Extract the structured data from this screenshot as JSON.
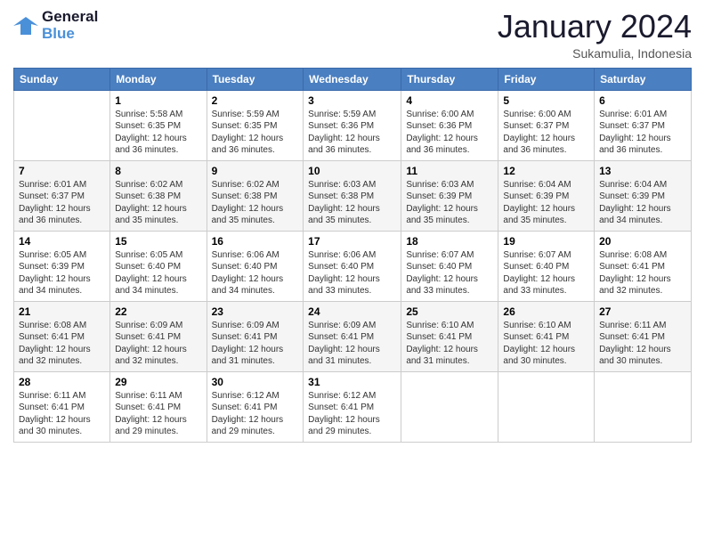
{
  "logo": {
    "line1": "General",
    "line2": "Blue"
  },
  "header": {
    "month": "January 2024",
    "location": "Sukamulia, Indonesia"
  },
  "weekdays": [
    "Sunday",
    "Monday",
    "Tuesday",
    "Wednesday",
    "Thursday",
    "Friday",
    "Saturday"
  ],
  "weeks": [
    [
      {
        "day": "",
        "info": ""
      },
      {
        "day": "1",
        "info": "Sunrise: 5:58 AM\nSunset: 6:35 PM\nDaylight: 12 hours and 36 minutes."
      },
      {
        "day": "2",
        "info": "Sunrise: 5:59 AM\nSunset: 6:35 PM\nDaylight: 12 hours and 36 minutes."
      },
      {
        "day": "3",
        "info": "Sunrise: 5:59 AM\nSunset: 6:36 PM\nDaylight: 12 hours and 36 minutes."
      },
      {
        "day": "4",
        "info": "Sunrise: 6:00 AM\nSunset: 6:36 PM\nDaylight: 12 hours and 36 minutes."
      },
      {
        "day": "5",
        "info": "Sunrise: 6:00 AM\nSunset: 6:37 PM\nDaylight: 12 hours and 36 minutes."
      },
      {
        "day": "6",
        "info": "Sunrise: 6:01 AM\nSunset: 6:37 PM\nDaylight: 12 hours and 36 minutes."
      }
    ],
    [
      {
        "day": "7",
        "info": "Sunrise: 6:01 AM\nSunset: 6:37 PM\nDaylight: 12 hours and 36 minutes."
      },
      {
        "day": "8",
        "info": "Sunrise: 6:02 AM\nSunset: 6:38 PM\nDaylight: 12 hours and 35 minutes."
      },
      {
        "day": "9",
        "info": "Sunrise: 6:02 AM\nSunset: 6:38 PM\nDaylight: 12 hours and 35 minutes."
      },
      {
        "day": "10",
        "info": "Sunrise: 6:03 AM\nSunset: 6:38 PM\nDaylight: 12 hours and 35 minutes."
      },
      {
        "day": "11",
        "info": "Sunrise: 6:03 AM\nSunset: 6:39 PM\nDaylight: 12 hours and 35 minutes."
      },
      {
        "day": "12",
        "info": "Sunrise: 6:04 AM\nSunset: 6:39 PM\nDaylight: 12 hours and 35 minutes."
      },
      {
        "day": "13",
        "info": "Sunrise: 6:04 AM\nSunset: 6:39 PM\nDaylight: 12 hours and 34 minutes."
      }
    ],
    [
      {
        "day": "14",
        "info": "Sunrise: 6:05 AM\nSunset: 6:39 PM\nDaylight: 12 hours and 34 minutes."
      },
      {
        "day": "15",
        "info": "Sunrise: 6:05 AM\nSunset: 6:40 PM\nDaylight: 12 hours and 34 minutes."
      },
      {
        "day": "16",
        "info": "Sunrise: 6:06 AM\nSunset: 6:40 PM\nDaylight: 12 hours and 34 minutes."
      },
      {
        "day": "17",
        "info": "Sunrise: 6:06 AM\nSunset: 6:40 PM\nDaylight: 12 hours and 33 minutes."
      },
      {
        "day": "18",
        "info": "Sunrise: 6:07 AM\nSunset: 6:40 PM\nDaylight: 12 hours and 33 minutes."
      },
      {
        "day": "19",
        "info": "Sunrise: 6:07 AM\nSunset: 6:40 PM\nDaylight: 12 hours and 33 minutes."
      },
      {
        "day": "20",
        "info": "Sunrise: 6:08 AM\nSunset: 6:41 PM\nDaylight: 12 hours and 32 minutes."
      }
    ],
    [
      {
        "day": "21",
        "info": "Sunrise: 6:08 AM\nSunset: 6:41 PM\nDaylight: 12 hours and 32 minutes."
      },
      {
        "day": "22",
        "info": "Sunrise: 6:09 AM\nSunset: 6:41 PM\nDaylight: 12 hours and 32 minutes."
      },
      {
        "day": "23",
        "info": "Sunrise: 6:09 AM\nSunset: 6:41 PM\nDaylight: 12 hours and 31 minutes."
      },
      {
        "day": "24",
        "info": "Sunrise: 6:09 AM\nSunset: 6:41 PM\nDaylight: 12 hours and 31 minutes."
      },
      {
        "day": "25",
        "info": "Sunrise: 6:10 AM\nSunset: 6:41 PM\nDaylight: 12 hours and 31 minutes."
      },
      {
        "day": "26",
        "info": "Sunrise: 6:10 AM\nSunset: 6:41 PM\nDaylight: 12 hours and 30 minutes."
      },
      {
        "day": "27",
        "info": "Sunrise: 6:11 AM\nSunset: 6:41 PM\nDaylight: 12 hours and 30 minutes."
      }
    ],
    [
      {
        "day": "28",
        "info": "Sunrise: 6:11 AM\nSunset: 6:41 PM\nDaylight: 12 hours and 30 minutes."
      },
      {
        "day": "29",
        "info": "Sunrise: 6:11 AM\nSunset: 6:41 PM\nDaylight: 12 hours and 29 minutes."
      },
      {
        "day": "30",
        "info": "Sunrise: 6:12 AM\nSunset: 6:41 PM\nDaylight: 12 hours and 29 minutes."
      },
      {
        "day": "31",
        "info": "Sunrise: 6:12 AM\nSunset: 6:41 PM\nDaylight: 12 hours and 29 minutes."
      },
      {
        "day": "",
        "info": ""
      },
      {
        "day": "",
        "info": ""
      },
      {
        "day": "",
        "info": ""
      }
    ]
  ]
}
